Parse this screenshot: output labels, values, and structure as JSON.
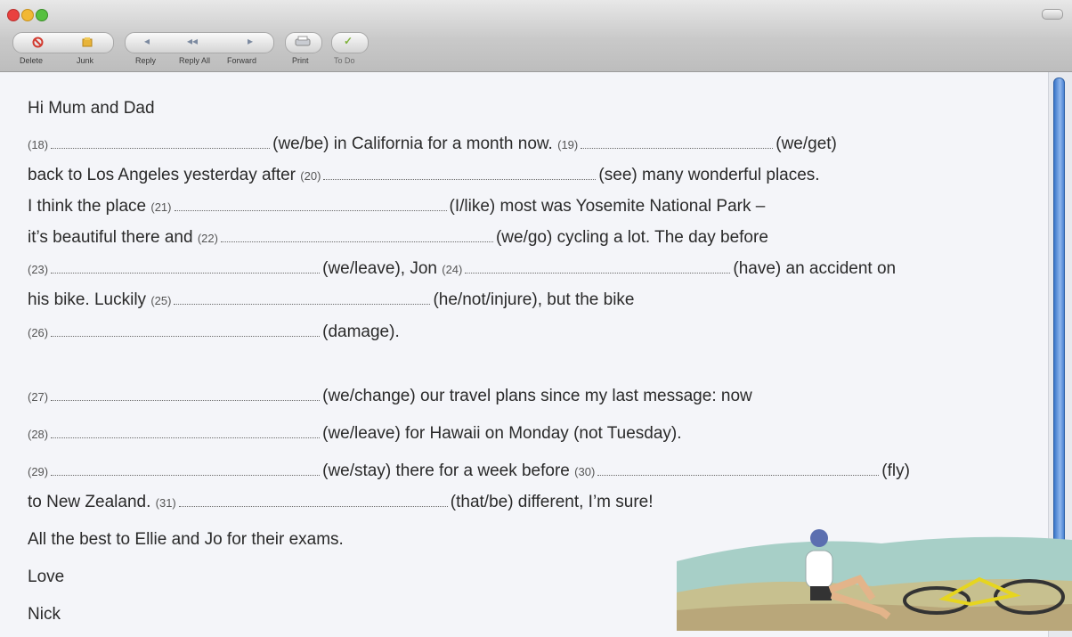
{
  "toolbar": {
    "delete": "Delete",
    "junk": "Junk",
    "reply": "Reply",
    "reply_all": "Reply All",
    "forward": "Forward",
    "print": "Print",
    "todo": "To Do"
  },
  "message": {
    "greeting": "Hi Mum and Dad",
    "lines": [
      {
        "n18": "(18)",
        "t1": "(we/be) in California for a month now.",
        "n19": "(19)",
        "t2": "(we/get)"
      },
      {
        "t1": "back to Los Angeles yesterday after",
        "n20": "(20)",
        "t2": "(see) many wonderful places."
      },
      {
        "t1": "I think the place",
        "n21": "(21)",
        "t2": "(I/like) most was Yosemite National Park –"
      },
      {
        "t1": "it’s beautiful there and",
        "n22": "(22)",
        "t2": "(we/go) cycling a lot.  The day before"
      },
      {
        "n23": "(23)",
        "t1": "(we/leave), Jon",
        "n24": "(24)",
        "t2": "(have) an accident on"
      },
      {
        "t1": "his bike.  Luckily",
        "n25": "(25)",
        "t2": "(he/not/injure), but the bike"
      },
      {
        "n26": "(26)",
        "t1": "(damage)."
      },
      {
        "n27": "(27)",
        "t1": "(we/change) our travel plans since my last message: now"
      },
      {
        "n28": "(28)",
        "t1": "(we/leave) for Hawaii on Monday (not Tuesday)."
      },
      {
        "n29": "(29)",
        "t1": "(we/stay) there for a week before",
        "n30": "(30)",
        "t2": "(fly)"
      },
      {
        "t1": "to New Zealand.",
        "n31": "(31)",
        "t2": "(that/be) different, I’m sure!"
      }
    ],
    "closing": "All the best to Ellie and Jo for their exams.",
    "love": "Love",
    "signature": "Nick"
  },
  "colors": {
    "accent": "#3a76c9"
  }
}
